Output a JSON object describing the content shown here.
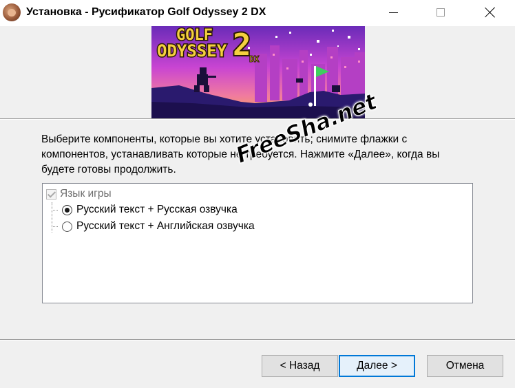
{
  "window": {
    "title": "Установка - Русификатор Golf Odyssey 2 DX",
    "icon": "app-icon"
  },
  "titlebar_buttons": {
    "minimize": "minimize-icon",
    "maximize": "maximize-icon",
    "close": "close-icon"
  },
  "banner": {
    "logo_line1": "GOLF",
    "logo_line2": "ODYSSEY",
    "logo_number": "2",
    "logo_suffix": "DX",
    "colors": {
      "sky_top": "#7b2fbe",
      "sky_mid": "#d44bd6",
      "sky_bottom": "#f7b04a",
      "ground": "#2a1a6e",
      "logo_fill": "#f4d03f",
      "flag": "#3ecf5e"
    }
  },
  "description": {
    "line1": "Выберите компоненты, которые вы хотите установить; снимите флажки с",
    "line2": "компонентов, устанавливать которые не требуется. Нажмите «Далее», когда вы",
    "line3": "будете готовы продолжить."
  },
  "watermark": {
    "text": "FreeSha.net"
  },
  "components": {
    "group_label": "Язык игры",
    "group_checked": true,
    "options": [
      {
        "label": "Русский текст + Русская озвучка",
        "selected": true
      },
      {
        "label": "Русский текст + Английская озвучка",
        "selected": false
      }
    ]
  },
  "buttons": {
    "back": "< Назад",
    "next": "Далее >",
    "cancel": "Отмена"
  },
  "accent_color": "#0078d7"
}
